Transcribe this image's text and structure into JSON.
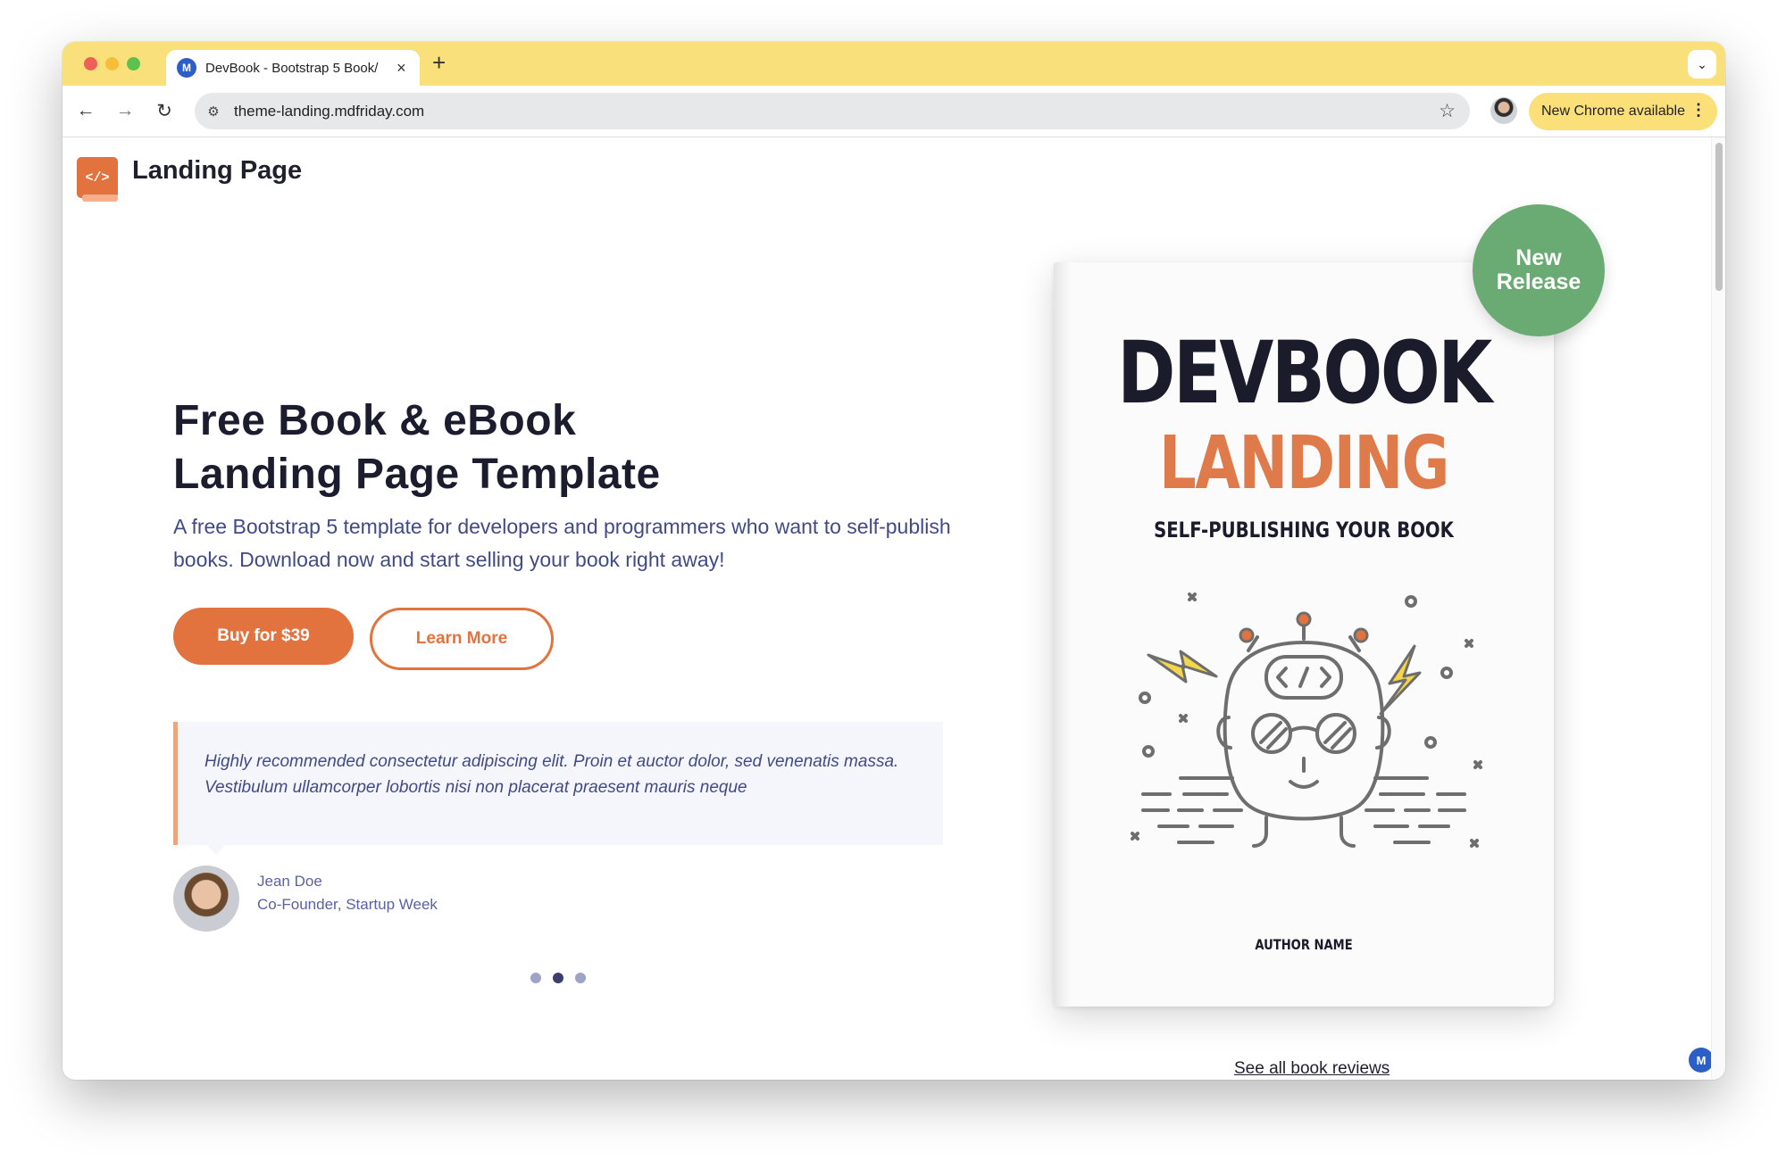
{
  "browser": {
    "tab": {
      "title": "DevBook - Bootstrap 5 Book/",
      "favicon": "M",
      "close_icon": "×"
    },
    "new_tab_icon": "+",
    "tab_menu_icon": "⌄",
    "nav": {
      "back_icon": "←",
      "forward_icon": "→",
      "reload_icon": "↻"
    },
    "site_info_icon": "⚙",
    "url": "theme-landing.mdfriday.com",
    "bookmark_icon": "☆",
    "update_label": "New Chrome available",
    "update_menu_icon": "⋮"
  },
  "header": {
    "logo_glyph": "</>",
    "site_name": "Landing Page"
  },
  "hero": {
    "headline_line1": "Free Book & eBook",
    "headline_line2": "Landing Page Template",
    "intro": "A free Bootstrap 5 template for developers and programmers who want to self-publish books. Download now and start selling your book right away!",
    "buy_label": "Buy for $39",
    "learn_label": "Learn More"
  },
  "testimonial": {
    "quote": "Highly recommended consectetur adipiscing elit. Proin et auctor dolor, sed venenatis massa. Vestibulum ullamcorper lobortis nisi non placerat praesent mauris neque",
    "author_name": "Jean Doe",
    "author_role": "Co-Founder, Startup Week",
    "slides": 3,
    "active_slide": 2
  },
  "book": {
    "title_line1": "DEVBOOK",
    "title_line2": "LANDING",
    "subtitle": "SELF-PUBLISHING YOUR BOOK",
    "author": "AUTHOR NAME",
    "badge_line1": "New",
    "badge_line2": "Release"
  },
  "reviews_link": "See all book reviews",
  "corner_icon": "M",
  "colors": {
    "accent": "#e2733e",
    "tab_bar": "#fae07a",
    "navy_text": "#414a86",
    "badge_green": "#6aab73",
    "book_orange": "#df7a4a"
  }
}
